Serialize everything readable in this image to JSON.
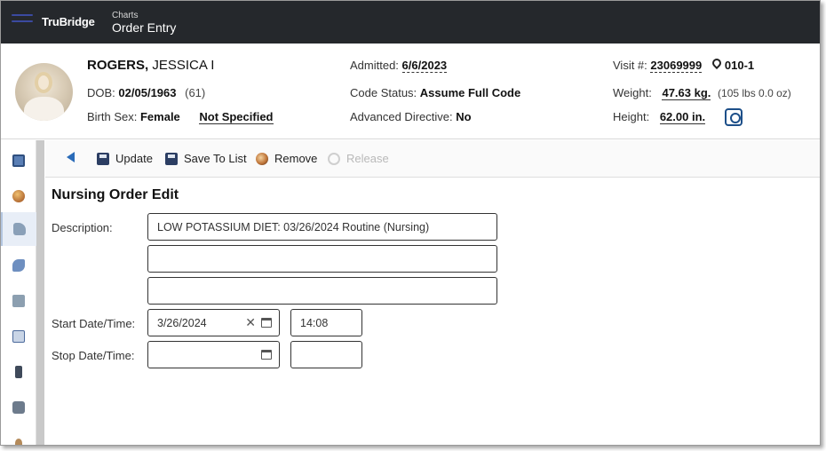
{
  "app": {
    "brand": "TruBridge",
    "breadcrumb_parent": "Charts",
    "breadcrumb_title": "Order Entry"
  },
  "patient": {
    "last_name": "ROGERS,",
    "first_name": "JESSICA I",
    "dob_label": "DOB:",
    "dob": "02/05/1963",
    "age": "(61)",
    "birth_sex_label": "Birth Sex:",
    "birth_sex": "Female",
    "gender_identity": "Not Specified",
    "admitted_label": "Admitted:",
    "admitted": "6/6/2023",
    "code_status_label": "Code Status:",
    "code_status": "Assume Full Code",
    "advanced_directive_label": "Advanced Directive:",
    "advanced_directive": "No",
    "visit_label": "Visit #:",
    "visit": "23069999",
    "room": "010-1",
    "weight_label": "Weight:",
    "weight": "47.63 kg.",
    "weight_lbs": "(105 lbs 0.0 oz)",
    "height_label": "Height:",
    "height": "62.00 in."
  },
  "toolbar": {
    "update": "Update",
    "save_to_list": "Save To List",
    "remove": "Remove",
    "release": "Release"
  },
  "form": {
    "title": "Nursing Order Edit",
    "description_label": "Description:",
    "description_1": "LOW POTASSIUM DIET: 03/26/2024 Routine (Nursing)",
    "description_2": "",
    "description_3": "",
    "start_label": "Start Date/Time:",
    "start_date": "3/26/2024",
    "start_time": "14:08",
    "stop_label": "Stop Date/Time:",
    "stop_date": "",
    "stop_time": ""
  },
  "rail_icons": [
    "chart-icon",
    "alert-icon",
    "orders-icon",
    "medication-icon",
    "pharmacy-icon",
    "document-icon",
    "device-icon",
    "database-icon"
  ]
}
